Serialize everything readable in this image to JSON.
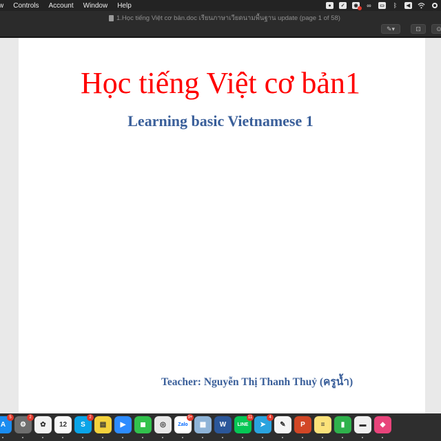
{
  "menubar": {
    "items": [
      "w",
      "Controls",
      "Account",
      "Window",
      "Help"
    ]
  },
  "status_icons": [
    "app-status-icon",
    "checkmark-status-icon",
    "notification-status-icon",
    "link-status-icon",
    "cast-status-icon",
    "bluetooth-icon",
    "sound-icon",
    "wifi-icon",
    "keyboard-input-icon"
  ],
  "window": {
    "title": "1.Học tiếng Việt cơ bản.doc เรียนภาษาเวียดนามพื้นฐาน update (page 1 of 58)"
  },
  "document": {
    "heading": "Học tiếng Việt cơ bản1",
    "subheading": "Learning basic Vietnamese 1",
    "teacher": "Teacher: Nguyễn Thị Thanh Thuỷ (ครูน้ำ)"
  },
  "dock": {
    "apps": [
      {
        "name": "App Store",
        "glyph": "A",
        "color": "#1a8cf0",
        "badge": "5"
      },
      {
        "name": "System Preferences",
        "glyph": "⚙",
        "color": "#6e6e6e",
        "badge": "2"
      },
      {
        "name": "Photos",
        "glyph": "✿",
        "color": "#f2f2f2",
        "badge": ""
      },
      {
        "name": "Calendar",
        "glyph": "12",
        "color": "#fafafa",
        "badge": ""
      },
      {
        "name": "Skype",
        "glyph": "S",
        "color": "#0aa4e8",
        "badge": "2"
      },
      {
        "name": "Stickies",
        "glyph": "▤",
        "color": "#f4d23c",
        "badge": ""
      },
      {
        "name": "Zoom",
        "glyph": "▶",
        "color": "#2d8cff",
        "badge": ""
      },
      {
        "name": "FaceTime",
        "glyph": "◼",
        "color": "#32c24d",
        "badge": ""
      },
      {
        "name": "Chrome",
        "glyph": "◎",
        "color": "#e8e8e8",
        "badge": ""
      },
      {
        "name": "Zalo",
        "glyph": "Zalo",
        "color": "#ffffff",
        "badge": "9+"
      },
      {
        "name": "Preview",
        "glyph": "▦",
        "color": "#8fb4d8",
        "badge": ""
      },
      {
        "name": "Word",
        "glyph": "W",
        "color": "#2b579a",
        "badge": ""
      },
      {
        "name": "LINE",
        "glyph": "LINE",
        "color": "#06c755",
        "badge": "11"
      },
      {
        "name": "Telegram",
        "glyph": "➤",
        "color": "#2aa3df",
        "badge": "4"
      },
      {
        "name": "Script Editor",
        "glyph": "✎",
        "color": "#f5f5f5",
        "badge": ""
      },
      {
        "name": "PowerPoint",
        "glyph": "P",
        "color": "#d24726",
        "badge": ""
      },
      {
        "name": "Notes",
        "glyph": "≡",
        "color": "#fbe27a",
        "badge": ""
      },
      {
        "name": "Numbers",
        "glyph": "▮",
        "color": "#2fb24c",
        "badge": ""
      },
      {
        "name": "Keynote",
        "glyph": "▬",
        "color": "#f0f0f0",
        "badge": ""
      },
      {
        "name": "CleanMyMac",
        "glyph": "◆",
        "color": "#e8447b",
        "badge": ""
      }
    ]
  }
}
